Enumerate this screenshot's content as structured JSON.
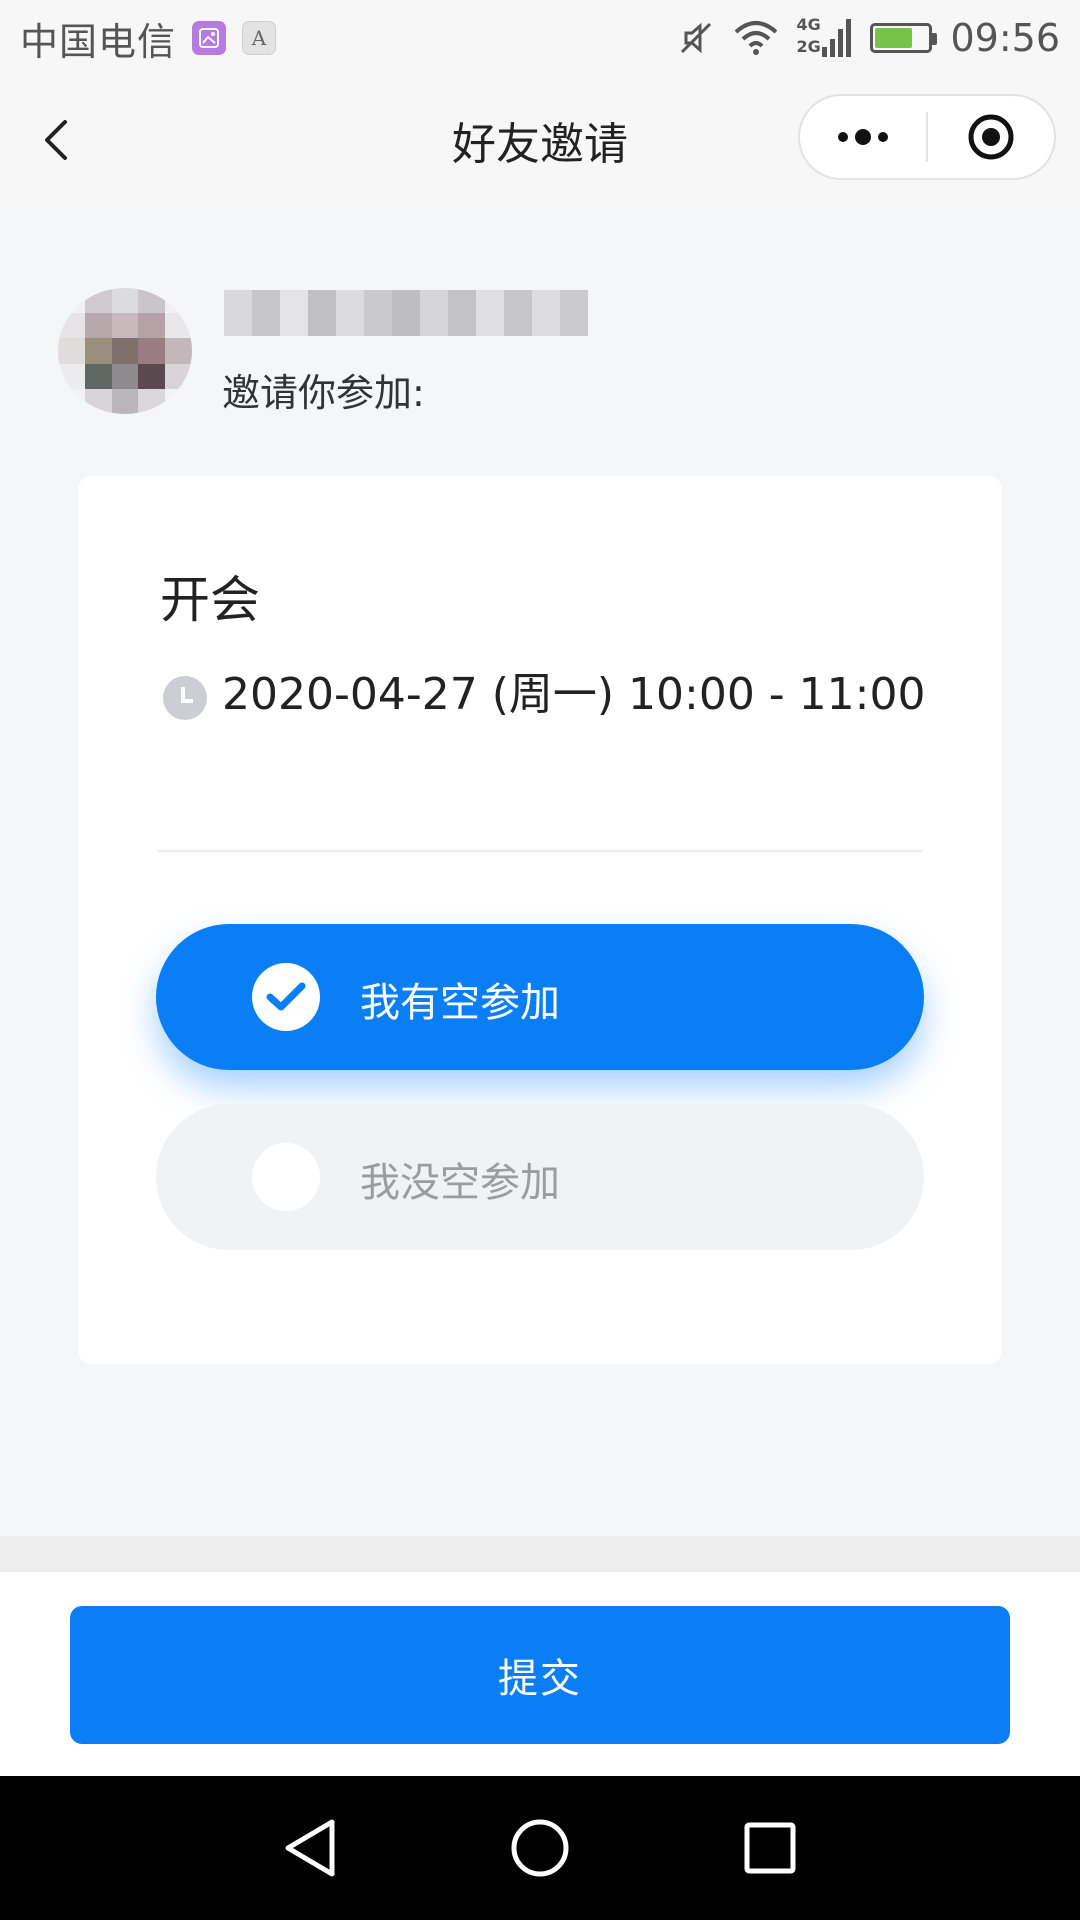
{
  "status_bar": {
    "carrier": "中国电信",
    "a_badge": "A",
    "time": "09:56",
    "network_4g": "4G",
    "network_2g": "2G"
  },
  "nav": {
    "title": "好友邀请"
  },
  "inviter": {
    "invite_text": "邀请你参加:"
  },
  "event": {
    "title": "开会",
    "datetime": "2020-04-27 (周一) 10:00 - 11:00"
  },
  "options": {
    "yes_label": "我有空参加",
    "no_label": "我没空参加",
    "selected": "yes"
  },
  "footer": {
    "submit_label": "提交"
  },
  "colors": {
    "accent": "#0a7ff5",
    "background": "#f5f6f8",
    "option_unselected": "#f1f2f4"
  },
  "icons": {
    "back": "chevron-left-icon",
    "more": "more-dots-icon",
    "close": "target-circle-icon",
    "clock": "clock-icon",
    "check": "check-icon"
  }
}
